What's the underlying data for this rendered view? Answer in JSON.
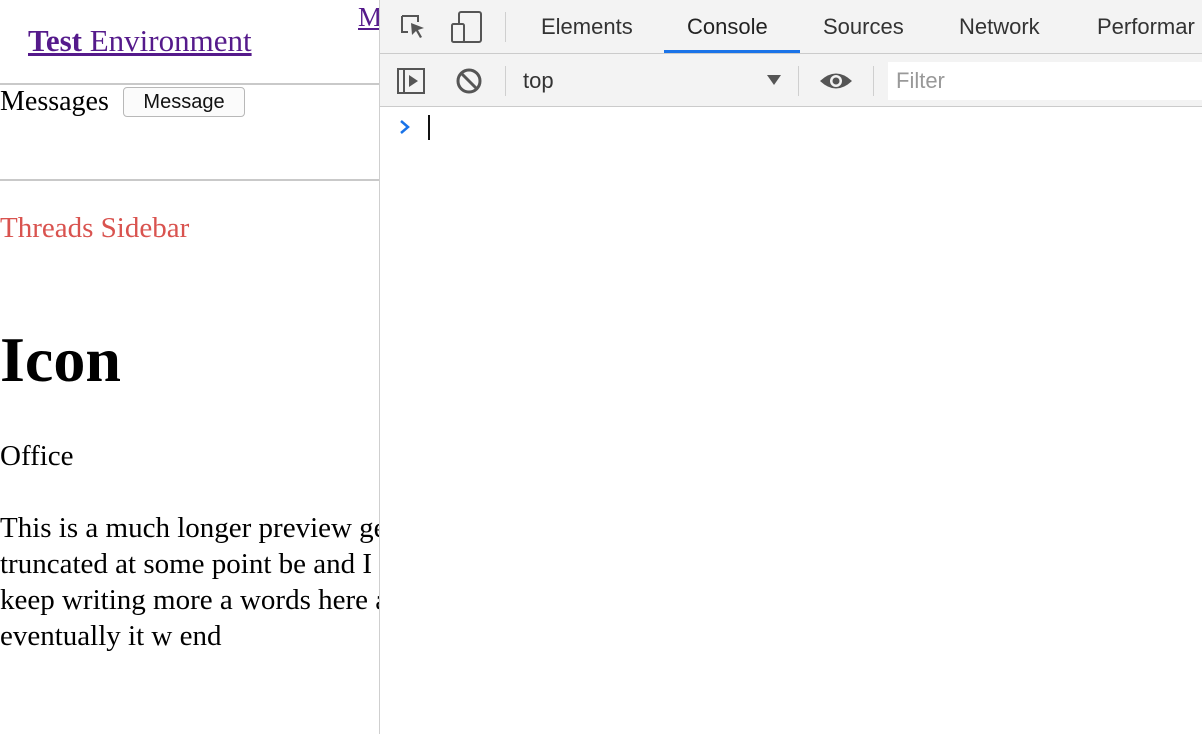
{
  "page": {
    "site_title_bold": "Test",
    "site_title_rest": " Environment",
    "nav_link_clipped": "M",
    "messages_label": "Messages",
    "message_button": "Message",
    "threads_sidebar": "Threads Sidebar",
    "icon_heading": "Icon",
    "office_label": "Office",
    "preview_text": "This is a much longer preview get truncated at some point be and I can keep writing more a words here and eventually it w end"
  },
  "devtools": {
    "tabs": [
      {
        "label": "Elements",
        "active": false
      },
      {
        "label": "Console",
        "active": true
      },
      {
        "label": "Sources",
        "active": false
      },
      {
        "label": "Network",
        "active": false
      },
      {
        "label": "Performar",
        "active": false
      }
    ],
    "icons": {
      "inspect": "inspect-element-icon",
      "device": "device-toolbar-icon",
      "sidebar": "show-sidebar-icon",
      "clear": "clear-console-icon",
      "eye": "live-expression-icon",
      "chevron": "prompt-chevron-icon"
    },
    "context": "top",
    "filter_placeholder": "Filter"
  },
  "colors": {
    "link": "#551a8b",
    "sidebar_red": "#d9534f",
    "devtools_bar": "#f3f3f3",
    "active_tab_blue": "#1a73e8",
    "prompt_blue": "#1a73e8"
  }
}
